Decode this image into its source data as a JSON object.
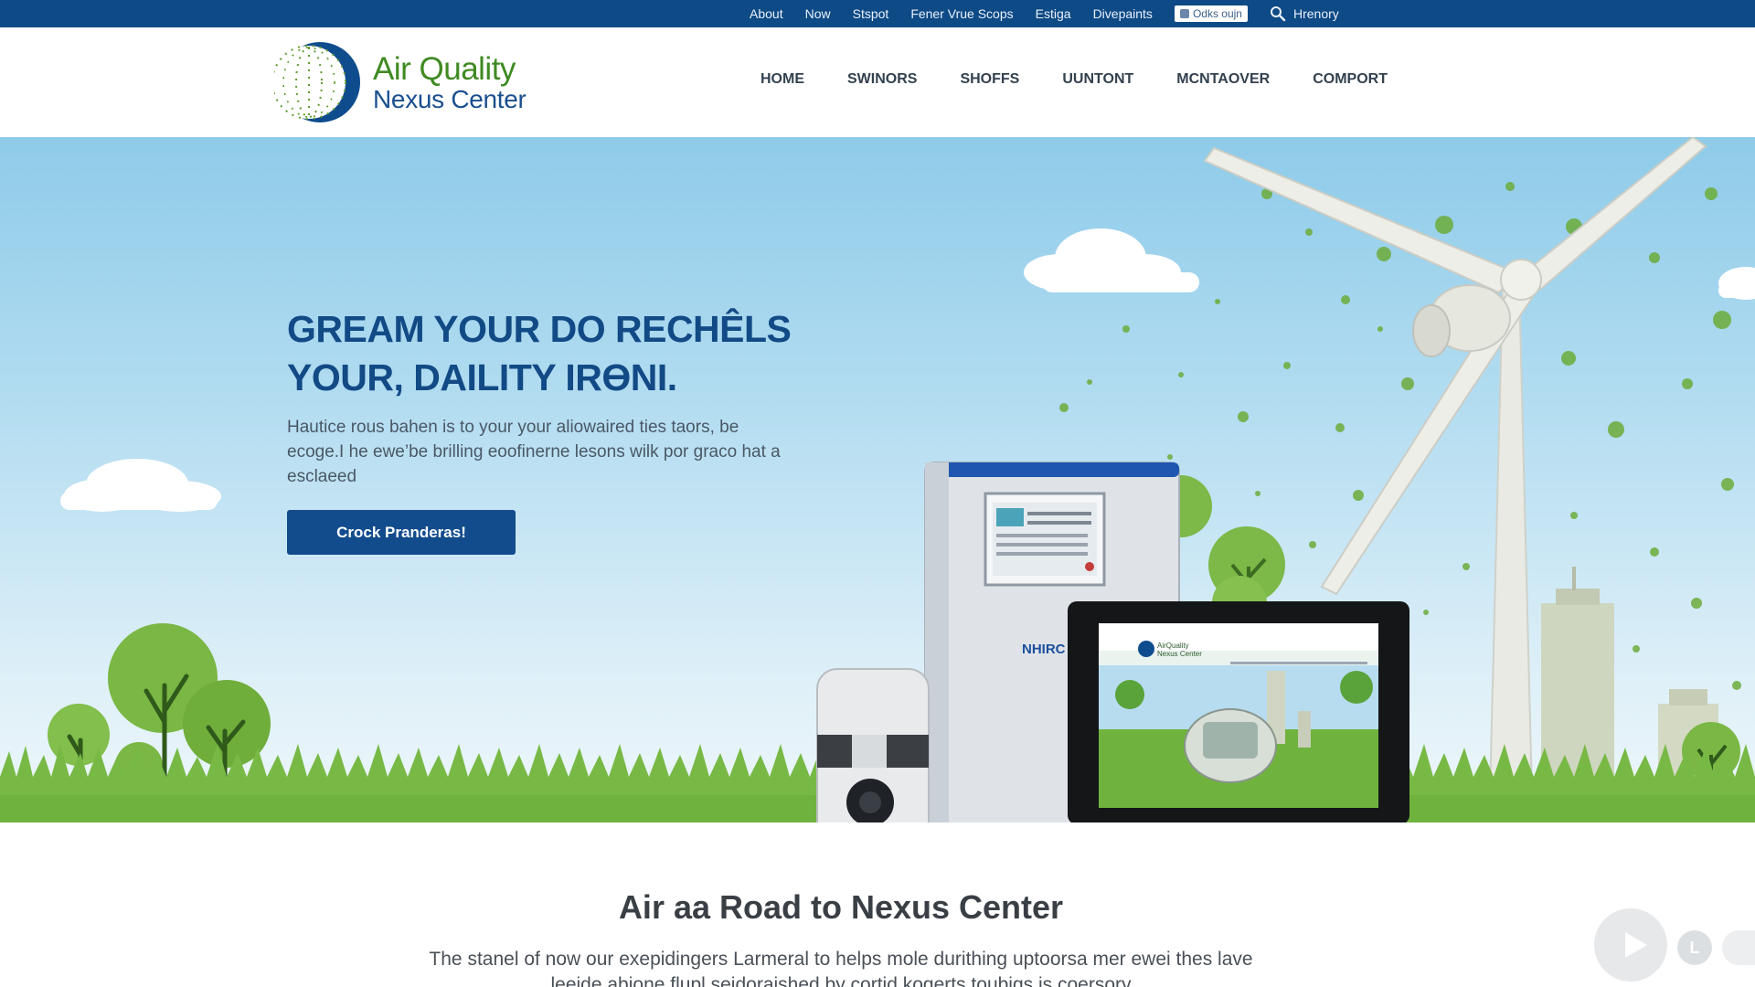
{
  "topbar": {
    "links": [
      "About",
      "Now",
      "Stspot",
      "Fener Vrue Scops",
      "Estiga",
      "Divepaints"
    ],
    "search_label": "Odks oujn",
    "account_label": "Hrenory"
  },
  "logo": {
    "line1": "Air Quality",
    "line2": "Nexus Center"
  },
  "nav": {
    "items": [
      "HOME",
      "SWINORS",
      "SHOFFS",
      "UUNTONT",
      "MCNTAOVER",
      "COMPORT"
    ]
  },
  "hero": {
    "title_line1": "GREAM YOUR DO RECHÊLS",
    "title_line2": "YOUR, DAILITY IRƟNI.",
    "text": "Hautice rous bahen is to your your aliowaired ties taors, be ecoge.I he ewe’be brilling eoofinerne lesons wilk por graco hat a esclaeed",
    "cta_label": "Crock Pranderas!",
    "device_label": "NHIRC",
    "laptop_logo_line1": "AirQuality",
    "laptop_logo_line2": "Nexus Center"
  },
  "section": {
    "title": "Air aa Road to Nexus Center",
    "text": "The stanel of now our exepidingers Larmeral to helps mole durithing uptoorsa mer ewei thes lave leeide abione flupl seidoraished by cortid kogerts toubigs is coersory"
  },
  "widgets": {
    "mini_label": "L"
  },
  "colors": {
    "topbar": "#0e4a85",
    "brand_blue": "#134c8c",
    "brand_green": "#3f8a22",
    "sky": "#8ecbe9",
    "grass": "#6fb33e"
  },
  "icons": {
    "search": "search-icon",
    "lock": "lock-icon",
    "play": "play-icon"
  }
}
